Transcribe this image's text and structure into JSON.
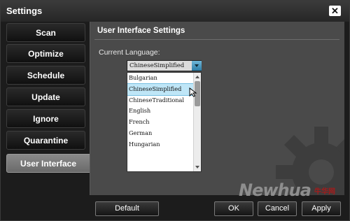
{
  "window": {
    "title": "Settings",
    "close_icon": "close-icon"
  },
  "sidebar": {
    "items": [
      {
        "label": "Scan"
      },
      {
        "label": "Optimize"
      },
      {
        "label": "Schedule"
      },
      {
        "label": "Update"
      },
      {
        "label": "Ignore"
      },
      {
        "label": "Quarantine"
      },
      {
        "label": "User Interface",
        "active": true
      }
    ]
  },
  "panel": {
    "title": "User Interface Settings",
    "language_label": "Current Language:",
    "selected_language": "ChineseSimplified",
    "options": [
      "Bulgarian",
      "ChineseSimplified",
      "ChineseTraditional",
      "English",
      "French",
      "German",
      "Hungarian"
    ]
  },
  "footer": {
    "default_label": "Default",
    "ok_label": "OK",
    "cancel_label": "Cancel",
    "apply_label": "Apply"
  },
  "watermark": {
    "text": "Newhua",
    "suffix": "牛华网"
  },
  "colors": {
    "accent": "#4aa9d6",
    "panel": "#4a4a4a",
    "dark": "#1c1c1c"
  }
}
